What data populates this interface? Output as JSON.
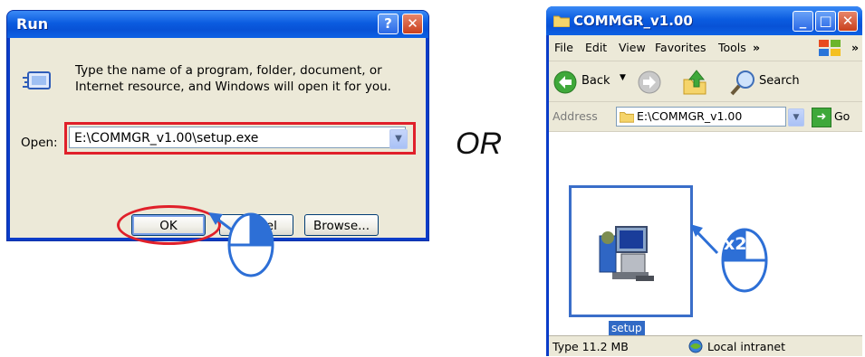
{
  "run_dialog": {
    "title": "Run",
    "description_line1": "Type the name of a program, folder, document, or",
    "description_line2": "Internet resource, and Windows will open it for you.",
    "open_label": "Open:",
    "open_value": "E:\\COMMGR_v1.00\\setup.exe",
    "ok_label": "OK",
    "cancel_label": "Cancel",
    "browse_label": "Browse...",
    "help_glyph": "?",
    "close_glyph": "✕"
  },
  "separator": {
    "text": "OR"
  },
  "explorer": {
    "title": "COMMGR_v1.00",
    "menu": [
      "File",
      "Edit",
      "View",
      "Favorites",
      "Tools",
      "»",
      "»"
    ],
    "back_label": "Back",
    "search_label": "Search",
    "address_label": "Address",
    "address_value": "E:\\COMMGR_v1.00",
    "go_label": "Go",
    "file_name": "setup",
    "status_type": "Type  11.2 MB",
    "status_zone": "Local intranet"
  },
  "annotations": {
    "double_click_label": "x2",
    "highlight_color": "#e0202a",
    "select_color": "#3a6ec9"
  }
}
